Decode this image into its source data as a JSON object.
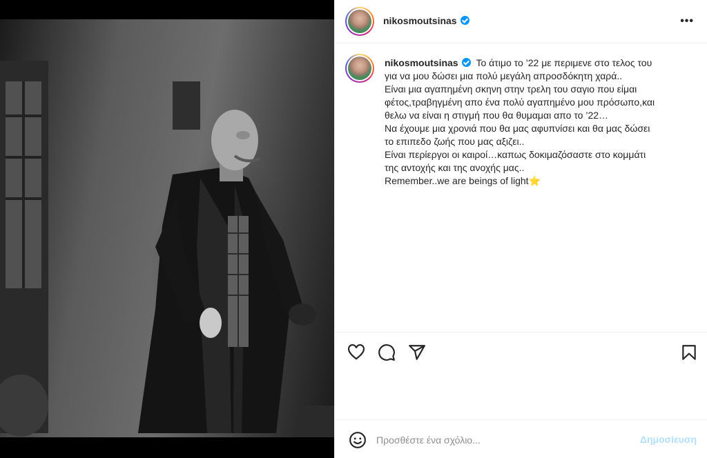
{
  "post": {
    "username": "nikosmoutsinas",
    "verified": true,
    "more_label": "•••",
    "caption_lines": [
      "Το άτιμο το ’22 με περιμενε στο τελος του",
      "για να μου δώσει μια πολύ μεγάλη απροσδόκητη χαρά..",
      "Είναι μια αγαπημένη σκηνη στην τρελη του σαγιο που είμαι",
      "φέτος,τραβηγμένη απο ένα πολύ αγαπημένο μου πρόσωπο,και",
      "θελω να είναι η στιγμή που θα θυμαμαι απο το ’22…",
      "Να έχουμε μια χρονιά που θα μας αφυπνίσει και θα μας δώσει",
      "το επιπεδο ζωής που μας αξιζει..",
      "Είναι περίεργοι οι καιροί…καπως δοκιμαζόσαστε στο κομμάτι",
      "της αντοχής και της ανοχής μας..",
      "Remember..we are beings of light⭐"
    ]
  },
  "actions": {
    "like_icon": "heart-icon",
    "comment_icon": "comment-icon",
    "share_icon": "send-icon",
    "save_icon": "bookmark-icon"
  },
  "comment": {
    "placeholder": "Προσθέστε ένα σχόλιο...",
    "post_label": "Δημοσίευση",
    "emoji_icon": "smiley-icon"
  },
  "colors": {
    "verified": "#0095f6",
    "post_button": "#b2dffc",
    "border": "#efefef"
  }
}
